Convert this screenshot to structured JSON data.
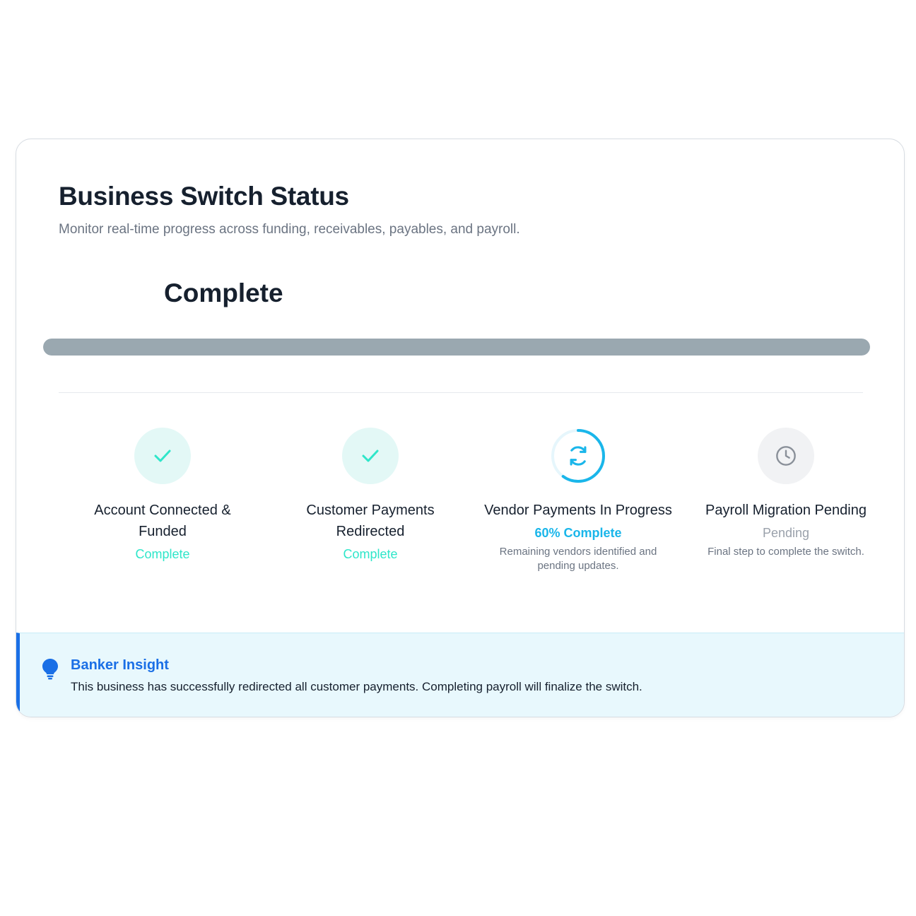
{
  "header": {
    "title": "Business Switch Status",
    "subtitle": "Monitor real-time progress across funding, receivables, payables, and payroll."
  },
  "overall": {
    "status_label": "Complete",
    "progress_fraction": 1.0
  },
  "steps": [
    {
      "title": "Account Connected & Funded",
      "status": "Complete",
      "note": "",
      "state": "complete",
      "icon": "check-icon"
    },
    {
      "title": "Customer Payments Redirected",
      "status": "Complete",
      "note": "",
      "state": "complete",
      "icon": "check-icon"
    },
    {
      "title": "Vendor Payments In Progress",
      "status": "60% Complete",
      "note": "Remaining vendors identified and pending updates.",
      "state": "in-progress",
      "icon": "refresh-icon",
      "progress_fraction": 0.6
    },
    {
      "title": "Payroll Migration Pending",
      "status": "Pending",
      "note": "Final step to complete the switch.",
      "state": "pending",
      "icon": "clock-icon"
    }
  ],
  "insight": {
    "title": "Banker Insight",
    "text": "This business has successfully redirected all customer payments. Completing payroll will finalize the switch.",
    "icon": "lightbulb-icon"
  },
  "colors": {
    "complete": "#2ee6c9",
    "in_progress": "#1ab6ea",
    "pending": "#9aa1ab",
    "accent": "#1a6fe6",
    "progress_bar": "#9aa8b0"
  }
}
